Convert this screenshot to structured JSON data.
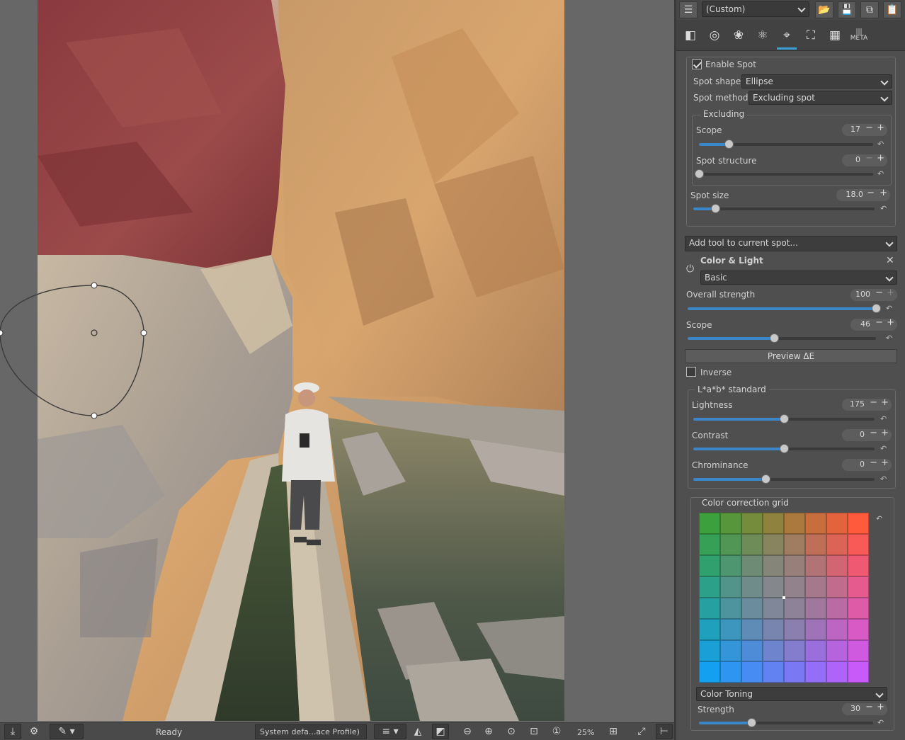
{
  "viewer": {
    "status": "Ready",
    "output_profile": "System defa...ace Profile)",
    "zoom": "25%"
  },
  "toolbar": {
    "profile": "(Custom)"
  },
  "tabs": [
    {
      "icon": "exposure-icon"
    },
    {
      "icon": "detail-icon"
    },
    {
      "icon": "color-icon"
    },
    {
      "icon": "advanced-icon"
    },
    {
      "icon": "local-adjustments-icon",
      "active": true
    },
    {
      "icon": "transform-icon"
    },
    {
      "icon": "raw-icon"
    },
    {
      "icon": "meta-icon",
      "label": "META"
    }
  ],
  "spot": {
    "enable_label": "Enable Spot",
    "enabled": true,
    "shape_label": "Spot shape:",
    "shape_value": "Ellipse",
    "method_label": "Spot method:",
    "method_value": "Excluding spot",
    "excluding": {
      "title": "Excluding",
      "scope_label": "Scope",
      "scope_value": "17",
      "scope_pos": 0.17,
      "structure_label": "Spot structure",
      "structure_value": "0",
      "structure_pos": 0.0
    },
    "size_label": "Spot size",
    "size_value": "18.0",
    "size_pos": 0.12
  },
  "add_tool": "Add tool to current spot...",
  "color_light": {
    "title": "Color & Light",
    "mode": "Basic",
    "overall_label": "Overall strength",
    "overall_value": "100",
    "overall_pos": 1.0,
    "scope_label": "Scope",
    "scope_value": "46",
    "scope_pos": 0.46,
    "preview_label": "Preview ΔE",
    "inverse_label": "Inverse",
    "lab_title": "L*a*b* standard",
    "lightness_label": "Lightness",
    "lightness_value": "175",
    "lightness_pos": 0.5,
    "contrast_label": "Contrast",
    "contrast_value": "0",
    "contrast_pos": 0.5,
    "chrominance_label": "Chrominance",
    "chrominance_value": "0",
    "chrominance_pos": 0.4,
    "grid_title": "Color correction grid",
    "toning_value": "Color Toning",
    "strength_label": "Strength",
    "strength_value": "30",
    "strength_pos": 0.3
  }
}
